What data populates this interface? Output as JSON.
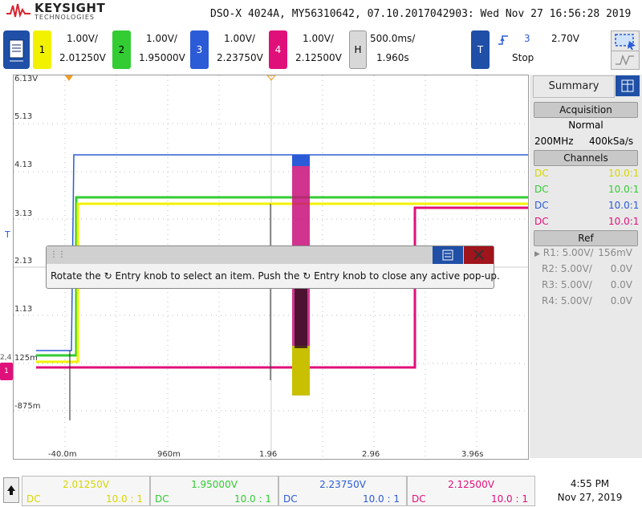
{
  "header": {
    "brand_name": "KEYSIGHT",
    "brand_sub": "TECHNOLOGIES",
    "title": "DSO-X 4024A, MY56310642, 07.10.2017042903: Wed Nov 27 16:56:28 2019"
  },
  "channels": [
    {
      "num": "1",
      "scale": "1.00V/",
      "offset": "2.01250V",
      "color": "#f2f200"
    },
    {
      "num": "2",
      "scale": "1.00V/",
      "offset": "1.95000V",
      "color": "#33cc33"
    },
    {
      "num": "3",
      "scale": "1.00V/",
      "offset": "2.23750V",
      "color": "#2b5bd7"
    },
    {
      "num": "4",
      "scale": "1.00V/",
      "offset": "2.12500V",
      "color": "#e0107a"
    }
  ],
  "horizontal": {
    "label": "H",
    "scale": "500.0ms/",
    "delay": "1.960s"
  },
  "trigger": {
    "label": "T",
    "source": "3",
    "level": "2.70V",
    "mode": "Stop"
  },
  "plot": {
    "y_labels": [
      "6.13V",
      "5.13",
      "4.13",
      "3.13",
      "2.13",
      "1.13",
      "125m",
      "-875m"
    ],
    "x_labels": [
      "-40.0m",
      "960m",
      "1.96",
      "2.96",
      "3.96s"
    ],
    "trigger_marker": "T",
    "ground_marker": "2,4",
    "ground_marker_ch1": "1"
  },
  "popup": {
    "text": "Rotate the ↻ Entry knob to select an item. Push the ↻ Entry knob to close any active pop-up."
  },
  "side": {
    "tab": "Summary",
    "acq_head": "Acquisition",
    "acq_mode": "Normal",
    "acq_bw": "200MHz",
    "acq_rate": "400kSa/s",
    "ch_head": "Channels",
    "ch_rows": [
      {
        "coupling": "DC",
        "probe": "10.0:1",
        "color": "#d6d600"
      },
      {
        "coupling": "DC",
        "probe": "10.0:1",
        "color": "#33cc33"
      },
      {
        "coupling": "DC",
        "probe": "10.0:1",
        "color": "#2b5bd7"
      },
      {
        "coupling": "DC",
        "probe": "10.0:1",
        "color": "#e0107a"
      }
    ],
    "ref_head": "Ref",
    "ref_rows": [
      {
        "name": "R1:",
        "scale": "5.00V/",
        "offset": "156mV"
      },
      {
        "name": "R2:",
        "scale": "5.00V/",
        "offset": "0.0V"
      },
      {
        "name": "R3:",
        "scale": "5.00V/",
        "offset": "0.0V"
      },
      {
        "name": "R4:",
        "scale": "5.00V/",
        "offset": "0.0V"
      }
    ]
  },
  "footer": {
    "cells": [
      {
        "value": "2.01250V",
        "coupling": "DC",
        "probe": "10.0 : 1",
        "color": "#d6d600"
      },
      {
        "value": "1.95000V",
        "coupling": "DC",
        "probe": "10.0 : 1",
        "color": "#33cc33"
      },
      {
        "value": "2.23750V",
        "coupling": "DC",
        "probe": "10.0 : 1",
        "color": "#2b5bd7"
      },
      {
        "value": "2.12500V",
        "coupling": "DC",
        "probe": "10.0 : 1",
        "color": "#e0107a"
      }
    ],
    "time": "4:55 PM",
    "date": "Nov 27, 2019"
  }
}
